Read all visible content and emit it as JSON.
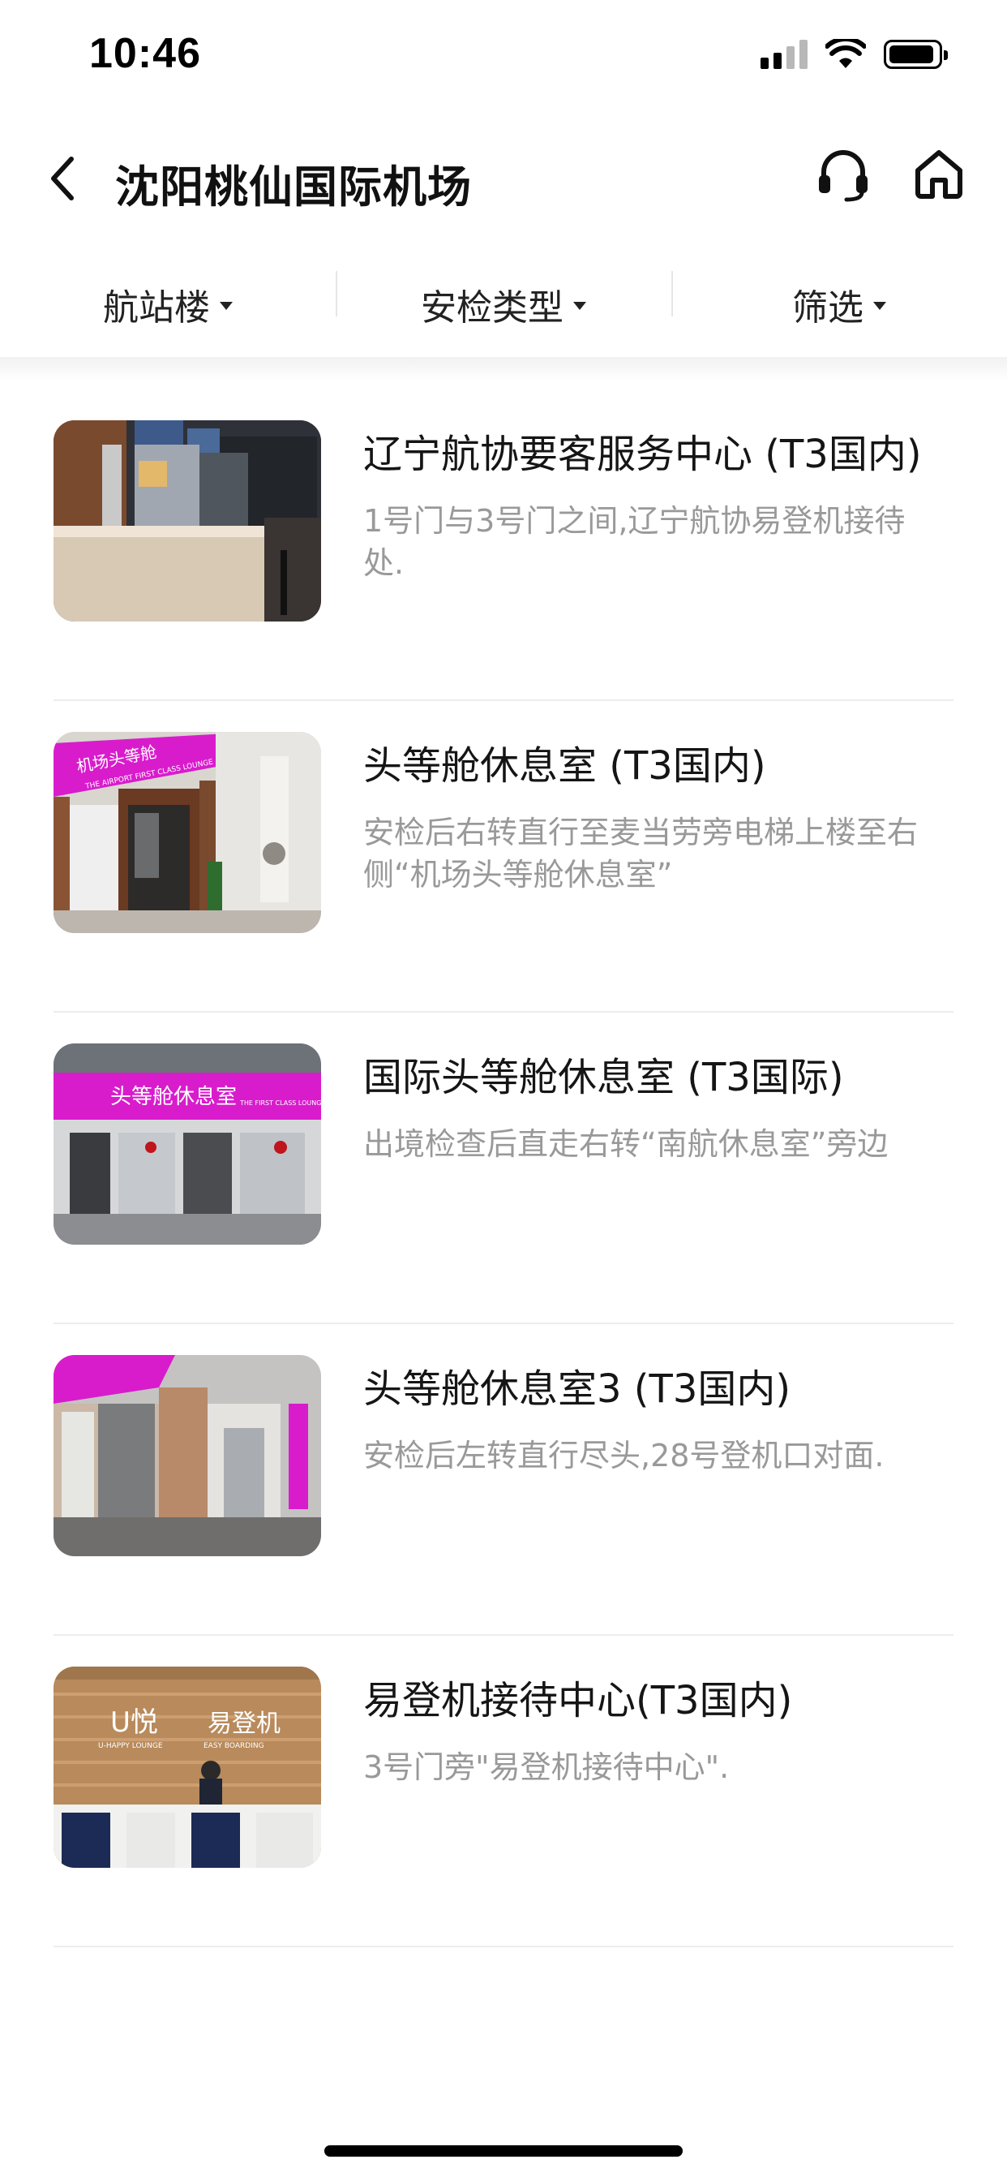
{
  "status_bar": {
    "time": "10:46"
  },
  "nav": {
    "title": "沈阳桃仙国际机场",
    "back_icon": "chevron-left-icon",
    "service_icon": "headset-icon",
    "home_icon": "home-icon"
  },
  "filters": [
    {
      "label": "航站楼"
    },
    {
      "label": "安检类型"
    },
    {
      "label": "筛选"
    }
  ],
  "lounges": [
    {
      "title": "辽宁航协要客服务中心 (T3国内)",
      "desc": "1号门与3号门之间,辽宁航协易登机接待处."
    },
    {
      "title": "头等舱休息室 (T3国内)",
      "desc": "安检后右转直行至麦当劳旁电梯上楼至右侧“机场头等舱休息室”"
    },
    {
      "title": "国际头等舱休息室 (T3国际)",
      "desc": "出境检查后直走右转“南航休息室”旁边"
    },
    {
      "title": "头等舱休息室3 (T3国内)",
      "desc": "安检后左转直行尽头,28号登机口对面."
    },
    {
      "title": "易登机接待中心(T3国内)",
      "desc": "3号门旁\"易登机接待中心\"."
    }
  ],
  "photo_text": {
    "lounge2_sign": "机场头等舱",
    "lounge2_sign_en": "THE AIRPORT FIRST CLASS LOUNGE",
    "lounge3_sign": "头等舱休息室",
    "lounge3_sign_en": "THE FIRST CLASS LOUNGE",
    "lounge5_left": "U悦",
    "lounge5_right": "易登机",
    "lounge5_left_en": "U-HAPPY LOUNGE",
    "lounge5_right_en": "EASY BOARDING"
  },
  "colors": {
    "accent_text": "#151515",
    "desc_text": "#999999",
    "signage_magenta": "#d81ccc"
  }
}
